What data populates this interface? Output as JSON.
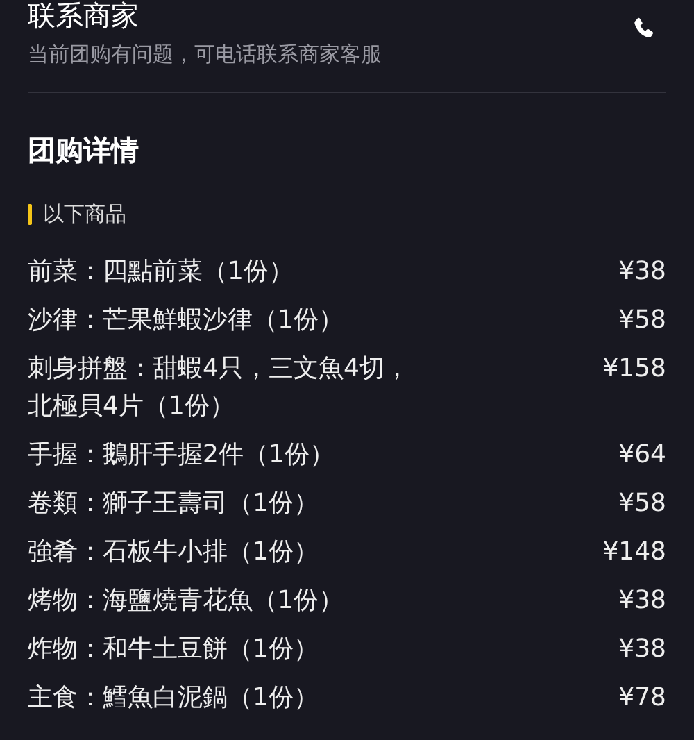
{
  "contact": {
    "title": "联系商家",
    "subtitle": "当前团购有问题，可电话联系商家客服"
  },
  "section_title": "团购详情",
  "group_title": "以下商品",
  "items": [
    {
      "name": "前菜：四點前菜（1份）",
      "price": "¥38"
    },
    {
      "name": "沙律：芒果鮮蝦沙律（1份）",
      "price": "¥58"
    },
    {
      "name": "刺身拼盤：甜蝦4只，三文魚4切，北極貝4片（1份）",
      "price": "¥158"
    },
    {
      "name": "手握：鵝肝手握2件（1份）",
      "price": "¥64"
    },
    {
      "name": "卷類：獅子王壽司（1份）",
      "price": "¥58"
    },
    {
      "name": "強肴：石板牛小排（1份）",
      "price": "¥148"
    },
    {
      "name": "烤物：海鹽燒青花魚（1份）",
      "price": "¥38"
    },
    {
      "name": "炸物：和牛土豆餅（1份）",
      "price": "¥38"
    },
    {
      "name": "主食：鱈魚白泥鍋（1份）",
      "price": "¥78"
    }
  ]
}
